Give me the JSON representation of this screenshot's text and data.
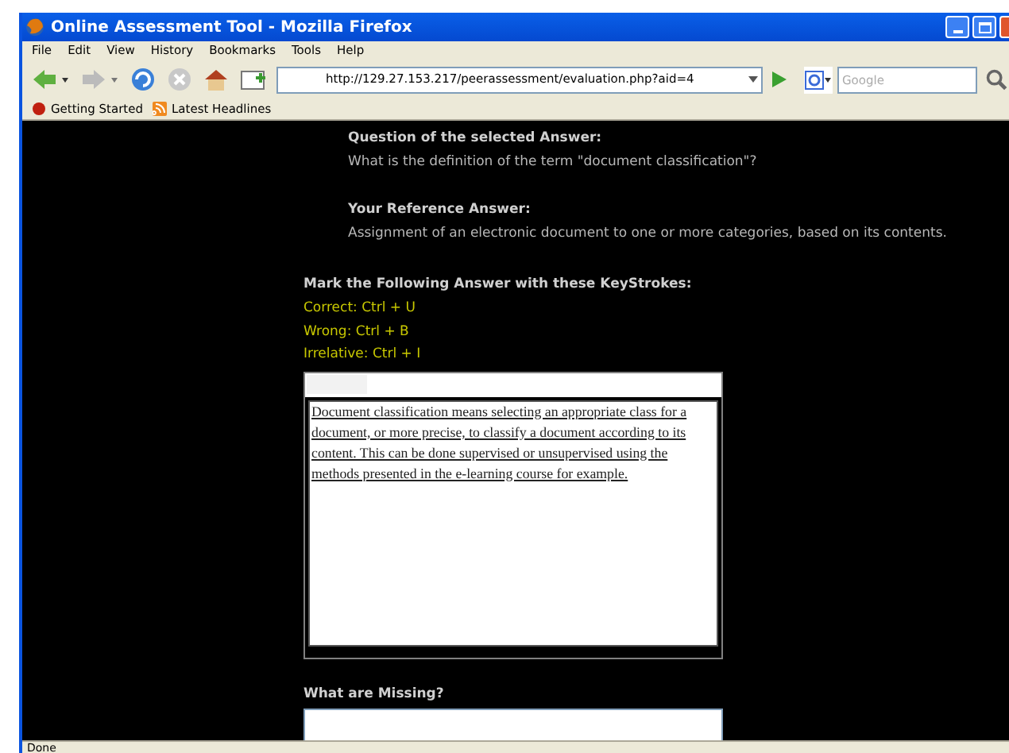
{
  "window": {
    "title": "Online Assessment Tool - Mozilla Firefox"
  },
  "menu": [
    "File",
    "Edit",
    "View",
    "History",
    "Bookmarks",
    "Tools",
    "Help"
  ],
  "address_bar": {
    "value": "http://129.27.153.217/peerassessment/evaluation.php?aid=4"
  },
  "search": {
    "placeholder": "Google"
  },
  "bookmarks": [
    "Getting Started",
    "Latest Headlines"
  ],
  "question": {
    "label": "Question of the selected Answer:",
    "text": "What is the definition of the term \"document classification\"?"
  },
  "reference": {
    "label": "Your Reference Answer:",
    "text": "Assignment of an electronic document to one or more categories, based on its contents."
  },
  "keystrokes": {
    "label": "Mark the Following Answer with these KeyStrokes:",
    "items": [
      "Correct: Ctrl + U",
      "Wrong: Ctrl + B",
      "Irrelative: Ctrl + I"
    ]
  },
  "answer": {
    "text": "Document classification means selecting an appropriate class for a document, or more precise, to classify a document according to its content. This can be done supervised or unsupervised using the methods presented in the e-learning course for example."
  },
  "missing": {
    "label": "What are Missing?"
  },
  "status_bar": "Done"
}
